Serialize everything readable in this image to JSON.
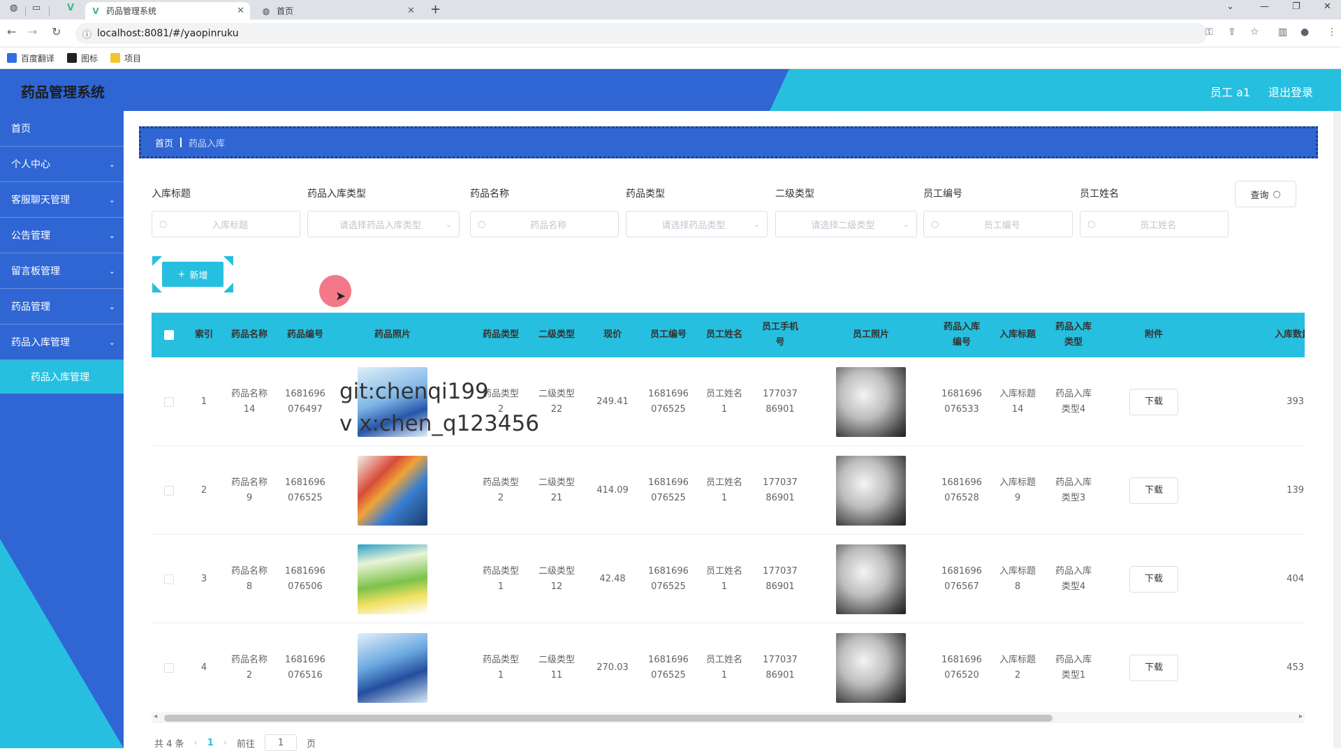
{
  "browser": {
    "tabs": [
      {
        "title": "药品管理系统"
      },
      {
        "title": "首页"
      }
    ],
    "url": "localhost:8081/#/yaopinruku",
    "bookmarks": [
      "百度翻译",
      "图标",
      "项目"
    ]
  },
  "header": {
    "title": "药品管理系统",
    "user": "员工 a1",
    "logout": "退出登录"
  },
  "sidebar": {
    "items": [
      {
        "label": "首页",
        "expandable": false
      },
      {
        "label": "个人中心",
        "expandable": true
      },
      {
        "label": "客服聊天管理",
        "expandable": true
      },
      {
        "label": "公告管理",
        "expandable": true
      },
      {
        "label": "留言板管理",
        "expandable": true
      },
      {
        "label": "药品管理",
        "expandable": true
      },
      {
        "label": "药品入库管理",
        "expandable": true
      }
    ],
    "active_sub": "药品入库管理"
  },
  "breadcrumb": {
    "home": "首页",
    "current": "药品入库"
  },
  "search": {
    "fields": [
      {
        "label": "入库标题",
        "placeholder": "入库标题",
        "type": "input"
      },
      {
        "label": "药品入库类型",
        "placeholder": "请选择药品入库类型",
        "type": "select"
      },
      {
        "label": "药品名称",
        "placeholder": "药品名称",
        "type": "input"
      },
      {
        "label": "药品类型",
        "placeholder": "请选择药品类型",
        "type": "select"
      },
      {
        "label": "二级类型",
        "placeholder": "请选择二级类型",
        "type": "select"
      },
      {
        "label": "员工编号",
        "placeholder": "员工编号",
        "type": "input"
      },
      {
        "label": "员工姓名",
        "placeholder": "员工姓名",
        "type": "input"
      }
    ],
    "query_label": "查询"
  },
  "add_label": "新增",
  "table": {
    "columns": [
      "索引",
      "药品名称",
      "药品编号",
      "药品照片",
      "药品类型",
      "二级类型",
      "现价",
      "员工编号",
      "员工姓名",
      "员工手机号",
      "员工照片",
      "药品入库编号",
      "入库标题",
      "药品入库类型",
      "附件",
      "入库数量"
    ],
    "rows": [
      {
        "index": "1",
        "name": "药品名称14",
        "code": "1681696076497",
        "type": "药品类型2",
        "subtype": "二级类型22",
        "price": "249.41",
        "emp_no": "1681696076525",
        "emp_name": "员工姓名1",
        "phone": "17703786901",
        "in_no": "1681696076533",
        "in_title": "入库标题14",
        "in_type": "药品入库类型4",
        "attach": "下载",
        "qty": "393"
      },
      {
        "index": "2",
        "name": "药品名称9",
        "code": "1681696076525",
        "type": "药品类型2",
        "subtype": "二级类型21",
        "price": "414.09",
        "emp_no": "1681696076525",
        "emp_name": "员工姓名1",
        "phone": "17703786901",
        "in_no": "1681696076528",
        "in_title": "入库标题9",
        "in_type": "药品入库类型3",
        "attach": "下载",
        "qty": "139"
      },
      {
        "index": "3",
        "name": "药品名称8",
        "code": "1681696076506",
        "type": "药品类型1",
        "subtype": "二级类型12",
        "price": "42.48",
        "emp_no": "1681696076525",
        "emp_name": "员工姓名1",
        "phone": "17703786901",
        "in_no": "1681696076567",
        "in_title": "入库标题8",
        "in_type": "药品入库类型4",
        "attach": "下载",
        "qty": "404"
      },
      {
        "index": "4",
        "name": "药品名称2",
        "code": "1681696076516",
        "type": "药品类型1",
        "subtype": "二级类型11",
        "price": "270.03",
        "emp_no": "1681696076525",
        "emp_name": "员工姓名1",
        "phone": "17703786901",
        "in_no": "1681696076520",
        "in_title": "入库标题2",
        "in_type": "药品入库类型1",
        "attach": "下载",
        "qty": "453"
      }
    ]
  },
  "pagination": {
    "total": "共 4 条",
    "current": "1",
    "goto_label": "前往",
    "goto_value": "1",
    "page_suffix": "页"
  },
  "watermark": {
    "line1": "git:chenqi199",
    "line2": "v x:chen_q123456"
  },
  "colors": {
    "primary": "#2f66d4",
    "accent": "#27bfdf"
  }
}
